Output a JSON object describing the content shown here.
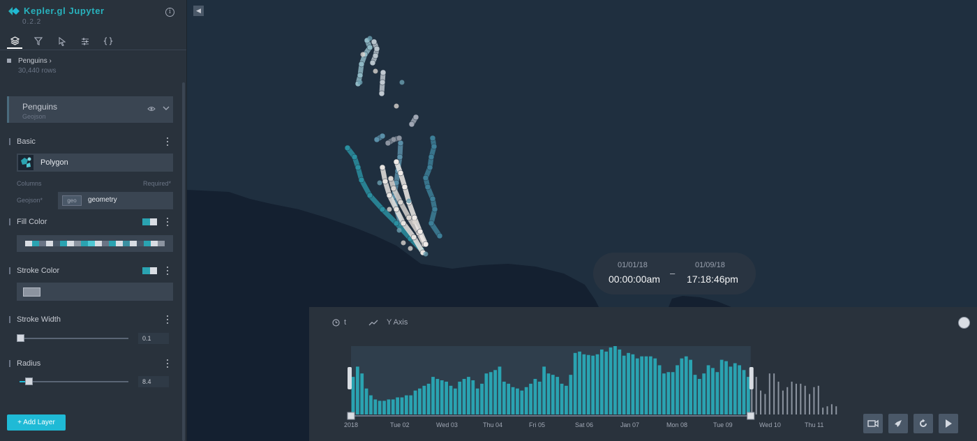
{
  "app": {
    "title": "Kepler.gl Jupyter",
    "version": "0.2.2"
  },
  "tabs": [
    "layers-icon",
    "filter-icon",
    "interaction-icon",
    "map-settings-icon",
    "config-icon"
  ],
  "dataset": {
    "name": "Penguins",
    "rows": "30,440 rows"
  },
  "layer": {
    "name": "Penguins",
    "type": "Geojson",
    "basic_title": "Basic",
    "layer_type_label": "Polygon",
    "columns_label": "Columns",
    "required_label": "Required*",
    "geojson_label": "Geojson*",
    "geo_tag": "geo",
    "geo_value": "geometry",
    "fill_color_title": "Fill Color",
    "stroke_color_title": "Stroke Color",
    "stroke_width_title": "Stroke Width",
    "stroke_width_value": "0.1",
    "radius_title": "Radius",
    "radius_value": "8.4"
  },
  "add_layer_label": "+ Add Layer",
  "colors": {
    "accent": "#1fbad6",
    "brand": "#28b2bd",
    "bar": "#2aa3b1",
    "bar_out": "#8c94a0"
  },
  "time_display": {
    "start_date": "01/01/18",
    "start_time": "00:00:00am",
    "separator": "–",
    "end_date": "01/09/18",
    "end_time": "17:18:46pm"
  },
  "timeline": {
    "field_label": "t",
    "yaxis_label": "Y Axis",
    "ticks": [
      "2018",
      "Tue 02",
      "Wed 03",
      "Thu 04",
      "Fri 05",
      "Sat 06",
      "Jan 07",
      "Mon 08",
      "Tue 09",
      "Wed 10",
      "Thu 11"
    ],
    "selected_range": [
      0,
      0.81
    ],
    "controls": [
      "duration-icon",
      "speed-icon",
      "reset-icon",
      "play-icon"
    ]
  },
  "chart_data": {
    "type": "bar",
    "x": [
      "2018",
      "Tue 02",
      "Wed 03",
      "Thu 04",
      "Fri 05",
      "Sat 06",
      "Jan 07",
      "Mon 08",
      "Tue 09",
      "Wed 10",
      "Thu 11"
    ],
    "values": [
      55,
      70,
      60,
      38,
      28,
      22,
      20,
      20,
      22,
      22,
      25,
      25,
      28,
      28,
      35,
      38,
      42,
      45,
      55,
      52,
      50,
      48,
      42,
      38,
      48,
      52,
      55,
      50,
      38,
      45,
      60,
      62,
      65,
      70,
      48,
      45,
      40,
      38,
      35,
      40,
      45,
      52,
      48,
      70,
      60,
      58,
      55,
      45,
      42,
      58,
      90,
      92,
      88,
      87,
      86,
      88,
      95,
      92,
      98,
      100,
      95,
      86,
      90,
      88,
      82,
      85,
      85,
      85,
      82,
      72,
      60,
      62,
      62,
      72,
      82,
      85,
      80,
      58,
      52,
      60,
      72,
      68,
      62,
      80,
      78,
      70,
      75,
      72,
      65,
      55,
      50,
      55,
      35,
      30,
      60,
      60,
      48,
      35,
      40,
      48,
      45,
      45,
      42,
      30,
      40,
      42,
      10,
      12,
      15,
      12
    ],
    "selected_count": 90,
    "ylim": [
      0,
      100
    ]
  }
}
